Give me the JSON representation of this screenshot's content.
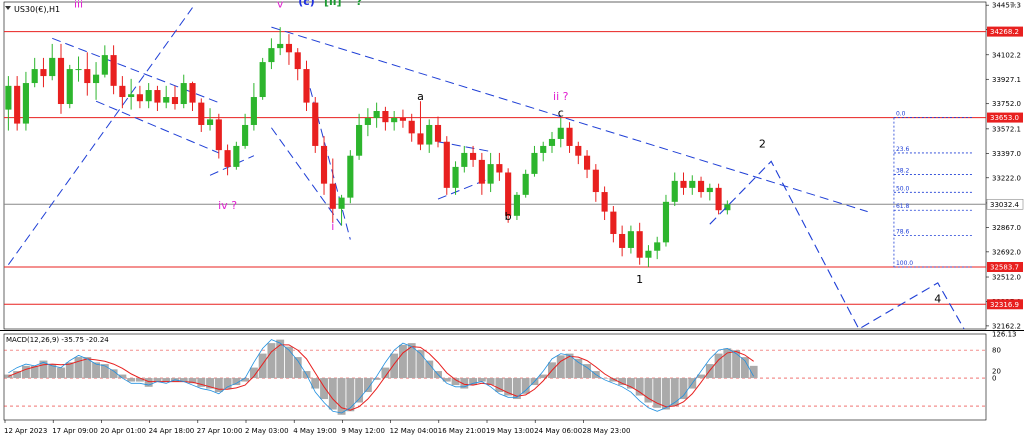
{
  "chart_data": [
    {
      "type": "line",
      "title": "US30(€),H1",
      "symbol_icon": "dropdown-triangle-icon",
      "price_ticks": [
        34457.3,
        34282.1,
        34102.2,
        33927.1,
        33752.0,
        33572.1,
        33397.0,
        33222.0,
        33042.0,
        32867.0,
        32692.0,
        32512.0,
        32337.0,
        32162.2
      ],
      "ylim": [
        32140,
        34480
      ],
      "x_ticks": [
        "12 Apr 2023",
        "17 Apr 09:00",
        "20 Apr 01:00",
        "24 Apr 18:00",
        "27 Apr 10:00",
        "2 May 03:00",
        "4 May 19:00",
        "9 May 12:00",
        "12 May 04:00",
        "16 May 21:00",
        "19 May 13:00",
        "24 May 06:00",
        "28 May 23:00"
      ],
      "horizontal_levels": [
        {
          "value": 34268.2,
          "label": "34268.2",
          "color": "#e8201f"
        },
        {
          "value": 33653.0,
          "label": "33653.0",
          "color": "#e8201f"
        },
        {
          "value": 32583.7,
          "label": "32583.7",
          "color": "#e8201f"
        },
        {
          "value": 32316.9,
          "label": "32316.9",
          "color": "#e8201f"
        },
        {
          "value": 33032.4,
          "label": "33032.4",
          "color": "#888888",
          "current": true
        }
      ],
      "fibonacci": {
        "color": "#1f3fd6",
        "levels": [
          {
            "label": "0.0",
            "value": 33653.0
          },
          {
            "label": "23.6",
            "value": 33400.0
          },
          {
            "label": "38.2",
            "value": 33245.0
          },
          {
            "label": "50.0",
            "value": 33118.0
          },
          {
            "label": "61.8",
            "value": 32990.0
          },
          {
            "label": "78.6",
            "value": 32810.0
          },
          {
            "label": "100.0",
            "value": 32583.7
          }
        ]
      },
      "wave_labels": [
        {
          "text": "iii",
          "color": "#e020d0",
          "bar": 8,
          "price": 34440
        },
        {
          "text": "v",
          "color": "#e020d0",
          "bar": 31,
          "price": 34440
        },
        {
          "text": "(c)",
          "color": "#2030e0",
          "bar": 34,
          "price": 34460
        },
        {
          "text": "[ii]",
          "color": "#1a9a30",
          "bar": 37,
          "price": 34460
        },
        {
          "text": "?",
          "color": "#1a9a30",
          "bar": 40,
          "price": 34460
        },
        {
          "text": "iv ?",
          "color": "#e020d0",
          "bar": 25,
          "price": 33000
        },
        {
          "text": "i",
          "color": "#e020d0",
          "bar": 37,
          "price": 32850
        },
        {
          "text": "a",
          "color": "#000000",
          "bar": 47,
          "price": 33780
        },
        {
          "text": "b",
          "color": "#000000",
          "bar": 57,
          "price": 32920
        },
        {
          "text": "ii ?",
          "color": "#e020d0",
          "bar": 63,
          "price": 33780
        },
        {
          "text": "c",
          "color": "#000000",
          "bar": 63,
          "price": 33660
        },
        {
          "text": "1",
          "color": "#000000",
          "bar": 72,
          "price": 32470
        },
        {
          "text": "2",
          "color": "#000000",
          "bar": 86,
          "price": 33440
        },
        {
          "text": "4",
          "color": "#000000",
          "bar": 106,
          "price": 32330
        }
      ],
      "trendlines": [
        {
          "from": {
            "bar": 0,
            "price": 32600
          },
          "to": {
            "bar": 21,
            "price": 34440
          }
        },
        {
          "from": {
            "bar": 5,
            "price": 34220
          },
          "to": {
            "bar": 24,
            "price": 33760
          }
        },
        {
          "from": {
            "bar": 10,
            "price": 33770
          },
          "to": {
            "bar": 24,
            "price": 33400
          }
        },
        {
          "from": {
            "bar": 23,
            "price": 33240
          },
          "to": {
            "bar": 28,
            "price": 33380
          }
        },
        {
          "from": {
            "bar": 30,
            "price": 34300
          },
          "to": {
            "bar": 98,
            "price": 32980
          }
        },
        {
          "from": {
            "bar": 34,
            "price": 33960
          },
          "to": {
            "bar": 39,
            "price": 32780
          }
        },
        {
          "from": {
            "bar": 30,
            "price": 33580
          },
          "to": {
            "bar": 38,
            "price": 32880
          }
        },
        {
          "from": {
            "bar": 49,
            "price": 33480
          },
          "to": {
            "bar": 55,
            "price": 33410
          }
        },
        {
          "from": {
            "bar": 49,
            "price": 33070
          },
          "to": {
            "bar": 55,
            "price": 33220
          }
        }
      ],
      "projection": {
        "points": [
          {
            "bar": 80,
            "price": 32890
          },
          {
            "bar": 87,
            "price": 33340
          },
          {
            "bar": 97,
            "price": 32140
          },
          {
            "bar": 106,
            "price": 32470
          },
          {
            "bar": 109,
            "price": 32140
          }
        ],
        "color": "#1f3fd6"
      },
      "candles": [
        {
          "o": 33710,
          "h": 33950,
          "l": 33560,
          "c": 33880
        },
        {
          "o": 33880,
          "h": 33950,
          "l": 33560,
          "c": 33610
        },
        {
          "o": 33610,
          "h": 33980,
          "l": 33560,
          "c": 33900
        },
        {
          "o": 33900,
          "h": 34080,
          "l": 33870,
          "c": 34000
        },
        {
          "o": 34000,
          "h": 34080,
          "l": 33870,
          "c": 33950
        },
        {
          "o": 33950,
          "h": 34180,
          "l": 33920,
          "c": 34080
        },
        {
          "o": 34080,
          "h": 34180,
          "l": 33680,
          "c": 33750
        },
        {
          "o": 33750,
          "h": 34030,
          "l": 33720,
          "c": 34000
        },
        {
          "o": 34000,
          "h": 34090,
          "l": 33910,
          "c": 34000
        },
        {
          "o": 34000,
          "h": 34120,
          "l": 33810,
          "c": 33900
        },
        {
          "o": 33900,
          "h": 34050,
          "l": 33780,
          "c": 33960
        },
        {
          "o": 33960,
          "h": 34170,
          "l": 33940,
          "c": 34100
        },
        {
          "o": 34100,
          "h": 34170,
          "l": 33820,
          "c": 33880
        },
        {
          "o": 33880,
          "h": 33950,
          "l": 33720,
          "c": 33800
        },
        {
          "o": 33800,
          "h": 33930,
          "l": 33710,
          "c": 33820
        },
        {
          "o": 33820,
          "h": 33880,
          "l": 33720,
          "c": 33770
        },
        {
          "o": 33770,
          "h": 33900,
          "l": 33720,
          "c": 33850
        },
        {
          "o": 33850,
          "h": 33880,
          "l": 33700,
          "c": 33760
        },
        {
          "o": 33760,
          "h": 33880,
          "l": 33720,
          "c": 33800
        },
        {
          "o": 33800,
          "h": 33880,
          "l": 33710,
          "c": 33750
        },
        {
          "o": 33750,
          "h": 33960,
          "l": 33720,
          "c": 33900
        },
        {
          "o": 33900,
          "h": 33910,
          "l": 33700,
          "c": 33760
        },
        {
          "o": 33760,
          "h": 33790,
          "l": 33550,
          "c": 33600
        },
        {
          "o": 33600,
          "h": 33720,
          "l": 33560,
          "c": 33640
        },
        {
          "o": 33640,
          "h": 33680,
          "l": 33360,
          "c": 33420
        },
        {
          "o": 33420,
          "h": 33460,
          "l": 33240,
          "c": 33300
        },
        {
          "o": 33300,
          "h": 33480,
          "l": 33280,
          "c": 33450
        },
        {
          "o": 33450,
          "h": 33680,
          "l": 33430,
          "c": 33600
        },
        {
          "o": 33600,
          "h": 33900,
          "l": 33560,
          "c": 33800
        },
        {
          "o": 33800,
          "h": 34080,
          "l": 33780,
          "c": 34050
        },
        {
          "o": 34050,
          "h": 34220,
          "l": 34000,
          "c": 34150
        },
        {
          "o": 34150,
          "h": 34300,
          "l": 34100,
          "c": 34180
        },
        {
          "o": 34180,
          "h": 34250,
          "l": 34030,
          "c": 34120
        },
        {
          "o": 34120,
          "h": 34150,
          "l": 33920,
          "c": 34000
        },
        {
          "o": 34000,
          "h": 34060,
          "l": 33700,
          "c": 33760
        },
        {
          "o": 33760,
          "h": 33800,
          "l": 33400,
          "c": 33450
        },
        {
          "o": 33450,
          "h": 33520,
          "l": 33100,
          "c": 33180
        },
        {
          "o": 33180,
          "h": 33360,
          "l": 32900,
          "c": 33000
        },
        {
          "o": 33000,
          "h": 33100,
          "l": 32880,
          "c": 33080
        },
        {
          "o": 33080,
          "h": 33420,
          "l": 33040,
          "c": 33380
        },
        {
          "o": 33380,
          "h": 33680,
          "l": 33350,
          "c": 33600
        },
        {
          "o": 33600,
          "h": 33720,
          "l": 33520,
          "c": 33650
        },
        {
          "o": 33650,
          "h": 33760,
          "l": 33580,
          "c": 33700
        },
        {
          "o": 33700,
          "h": 33730,
          "l": 33560,
          "c": 33620
        },
        {
          "o": 33620,
          "h": 33700,
          "l": 33560,
          "c": 33650
        },
        {
          "o": 33650,
          "h": 33710,
          "l": 33580,
          "c": 33630
        },
        {
          "o": 33630,
          "h": 33680,
          "l": 33480,
          "c": 33540
        },
        {
          "o": 33540,
          "h": 33770,
          "l": 33420,
          "c": 33460
        },
        {
          "o": 33460,
          "h": 33640,
          "l": 33400,
          "c": 33600
        },
        {
          "o": 33600,
          "h": 33660,
          "l": 33440,
          "c": 33480
        },
        {
          "o": 33480,
          "h": 33520,
          "l": 33100,
          "c": 33150
        },
        {
          "o": 33150,
          "h": 33340,
          "l": 33100,
          "c": 33300
        },
        {
          "o": 33300,
          "h": 33450,
          "l": 33260,
          "c": 33400
        },
        {
          "o": 33400,
          "h": 33450,
          "l": 33300,
          "c": 33350
        },
        {
          "o": 33350,
          "h": 33400,
          "l": 33100,
          "c": 33180
        },
        {
          "o": 33180,
          "h": 33400,
          "l": 33120,
          "c": 33320
        },
        {
          "o": 33320,
          "h": 33400,
          "l": 33200,
          "c": 33260
        },
        {
          "o": 33260,
          "h": 33290,
          "l": 32900,
          "c": 32950
        },
        {
          "o": 32950,
          "h": 33120,
          "l": 32920,
          "c": 33100
        },
        {
          "o": 33100,
          "h": 33280,
          "l": 33080,
          "c": 33250
        },
        {
          "o": 33250,
          "h": 33450,
          "l": 33230,
          "c": 33400
        },
        {
          "o": 33400,
          "h": 33480,
          "l": 33340,
          "c": 33450
        },
        {
          "o": 33450,
          "h": 33550,
          "l": 33400,
          "c": 33500
        },
        {
          "o": 33500,
          "h": 33650,
          "l": 33440,
          "c": 33580
        },
        {
          "o": 33580,
          "h": 33620,
          "l": 33400,
          "c": 33450
        },
        {
          "o": 33450,
          "h": 33480,
          "l": 33320,
          "c": 33380
        },
        {
          "o": 33380,
          "h": 33420,
          "l": 33220,
          "c": 33280
        },
        {
          "o": 33280,
          "h": 33320,
          "l": 33050,
          "c": 33120
        },
        {
          "o": 33120,
          "h": 33160,
          "l": 32920,
          "c": 32980
        },
        {
          "o": 32980,
          "h": 33020,
          "l": 32760,
          "c": 32820
        },
        {
          "o": 32820,
          "h": 32880,
          "l": 32660,
          "c": 32720
        },
        {
          "o": 32720,
          "h": 32880,
          "l": 32680,
          "c": 32840
        },
        {
          "o": 32840,
          "h": 32900,
          "l": 32600,
          "c": 32650
        },
        {
          "o": 32650,
          "h": 32740,
          "l": 32583,
          "c": 32700
        },
        {
          "o": 32700,
          "h": 32800,
          "l": 32640,
          "c": 32760
        },
        {
          "o": 32760,
          "h": 33100,
          "l": 32730,
          "c": 33050
        },
        {
          "o": 33050,
          "h": 33260,
          "l": 33020,
          "c": 33200
        },
        {
          "o": 33200,
          "h": 33260,
          "l": 33100,
          "c": 33150
        },
        {
          "o": 33150,
          "h": 33240,
          "l": 33100,
          "c": 33200
        },
        {
          "o": 33200,
          "h": 33230,
          "l": 33080,
          "c": 33120
        },
        {
          "o": 33120,
          "h": 33180,
          "l": 33060,
          "c": 33150
        },
        {
          "o": 33150,
          "h": 33180,
          "l": 32960,
          "c": 32990
        },
        {
          "o": 32990,
          "h": 33060,
          "l": 32960,
          "c": 33032
        }
      ]
    },
    {
      "type": "line",
      "title": "MACD(12,26,9) -35.75 -20.24",
      "levels": [
        126.13,
        80,
        0,
        20
      ],
      "level_lines": [
        80,
        0,
        -80
      ],
      "ylim": [
        -120,
        126.13
      ],
      "histogram": [
        10,
        20,
        35,
        35,
        50,
        40,
        30,
        45,
        60,
        60,
        45,
        40,
        25,
        10,
        -10,
        -10,
        -25,
        -10,
        -10,
        -10,
        -10,
        -15,
        -25,
        -30,
        -40,
        -30,
        -20,
        -10,
        30,
        70,
        100,
        110,
        90,
        60,
        20,
        -30,
        -60,
        -90,
        -105,
        -95,
        -70,
        -40,
        -5,
        30,
        70,
        95,
        100,
        80,
        50,
        20,
        -10,
        -20,
        -30,
        -20,
        -10,
        -20,
        -40,
        -50,
        -60,
        -45,
        -20,
        10,
        45,
        65,
        70,
        55,
        40,
        20,
        0,
        -10,
        -20,
        -30,
        -50,
        -70,
        -85,
        -90,
        -80,
        -60,
        -30,
        10,
        40,
        70,
        85,
        80,
        60,
        35
      ],
      "signal": [
        5,
        15,
        25,
        32,
        38,
        40,
        38,
        40,
        48,
        55,
        52,
        48,
        40,
        28,
        12,
        0,
        -10,
        -10,
        -10,
        -10,
        -10,
        -12,
        -18,
        -25,
        -32,
        -32,
        -28,
        -20,
        5,
        40,
        75,
        95,
        95,
        80,
        55,
        15,
        -25,
        -60,
        -85,
        -92,
        -82,
        -60,
        -30,
        5,
        40,
        72,
        90,
        88,
        70,
        45,
        15,
        -5,
        -18,
        -20,
        -15,
        -18,
        -30,
        -42,
        -52,
        -48,
        -32,
        -8,
        22,
        48,
        62,
        60,
        50,
        32,
        12,
        -3,
        -15,
        -25,
        -40,
        -58,
        -72,
        -82,
        -80,
        -68,
        -45,
        -12,
        22,
        52,
        72,
        76,
        66,
        48
      ],
      "macd": [
        15,
        30,
        40,
        35,
        45,
        35,
        30,
        50,
        65,
        55,
        40,
        35,
        20,
        0,
        -15,
        -15,
        -20,
        -10,
        -15,
        -5,
        -10,
        -20,
        -30,
        -35,
        -45,
        -25,
        -15,
        0,
        45,
        85,
        110,
        100,
        80,
        50,
        10,
        -40,
        -70,
        -95,
        -100,
        -85,
        -60,
        -30,
        5,
        45,
        80,
        100,
        90,
        70,
        40,
        10,
        -15,
        -25,
        -25,
        -15,
        -10,
        -25,
        -45,
        -55,
        -55,
        -35,
        -10,
        20,
        55,
        70,
        65,
        45,
        30,
        10,
        -5,
        -15,
        -25,
        -40,
        -65,
        -85,
        -95,
        -85,
        -70,
        -50,
        -15,
        20,
        55,
        80,
        85,
        70,
        50,
        5
      ],
      "series": [
        {
          "name": "",
          "color": "#aaaaaa"
        },
        {
          "name": "",
          "color": "#e8201f"
        },
        {
          "name": "",
          "color": "#2090e0"
        }
      ]
    }
  ],
  "colors": {
    "up": "#2db52d",
    "down": "#e8201f",
    "trend": "#1f3fd6",
    "axis": "#000000"
  }
}
